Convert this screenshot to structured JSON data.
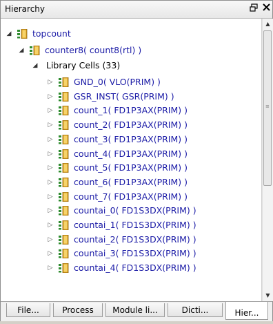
{
  "panel": {
    "title": "Hierarchy",
    "float_icon": "float-window-icon",
    "close_icon": "close-icon"
  },
  "tree": {
    "root": {
      "label": "topcount"
    },
    "module": {
      "label": "counter8( count8(rtl) )"
    },
    "group": {
      "label": "Library Cells (33)"
    },
    "cells": [
      {
        "label": "GND_0( VLO(PRIM) )"
      },
      {
        "label": "GSR_INST( GSR(PRIM) )"
      },
      {
        "label": "count_1( FD1P3AX(PRIM) )"
      },
      {
        "label": "count_2( FD1P3AX(PRIM) )"
      },
      {
        "label": "count_3( FD1P3AX(PRIM) )"
      },
      {
        "label": "count_4( FD1P3AX(PRIM) )"
      },
      {
        "label": "count_5( FD1P3AX(PRIM) )"
      },
      {
        "label": "count_6( FD1P3AX(PRIM) )"
      },
      {
        "label": "count_7( FD1P3AX(PRIM) )"
      },
      {
        "label": "countai_0( FD1S3DX(PRIM) )"
      },
      {
        "label": "countai_1( FD1S3DX(PRIM) )"
      },
      {
        "label": "countai_2( FD1S3DX(PRIM) )"
      },
      {
        "label": "countai_3( FD1S3DX(PRIM) )"
      },
      {
        "label": "countai_4( FD1S3DX(PRIM) )"
      }
    ]
  },
  "tabs": [
    {
      "label": "File..."
    },
    {
      "label": "Process"
    },
    {
      "label": "Module li..."
    },
    {
      "label": "Dicti..."
    },
    {
      "label": "Hier..."
    }
  ],
  "active_tab": "Hier...",
  "colors": {
    "link_blue": "#1a1aa6",
    "icon_green": "#2e8b2e"
  }
}
